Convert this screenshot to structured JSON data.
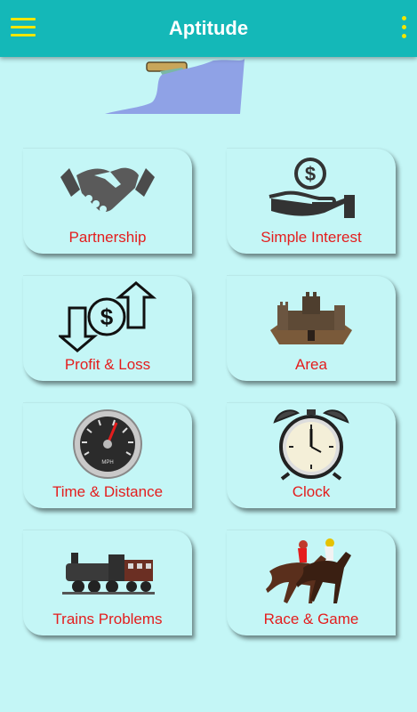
{
  "app": {
    "title": "Aptitude"
  },
  "topics": [
    {
      "label": "Partnership",
      "icon": "handshake-icon"
    },
    {
      "label": "Simple Interest",
      "icon": "money-hand-icon"
    },
    {
      "label": "Profit & Loss",
      "icon": "profit-loss-arrows-icon"
    },
    {
      "label": "Area",
      "icon": "castle-icon"
    },
    {
      "label": "Time & Distance",
      "icon": "speedometer-icon"
    },
    {
      "label": "Clock",
      "icon": "alarm-clock-icon"
    },
    {
      "label": "Trains Problems",
      "icon": "train-icon"
    },
    {
      "label": "Race & Game",
      "icon": "horse-race-icon"
    }
  ],
  "colors": {
    "appbar": "#14b8b8",
    "background": "#c4f6f6",
    "label": "#e41d1d",
    "menu_icons": "#f2e600"
  }
}
